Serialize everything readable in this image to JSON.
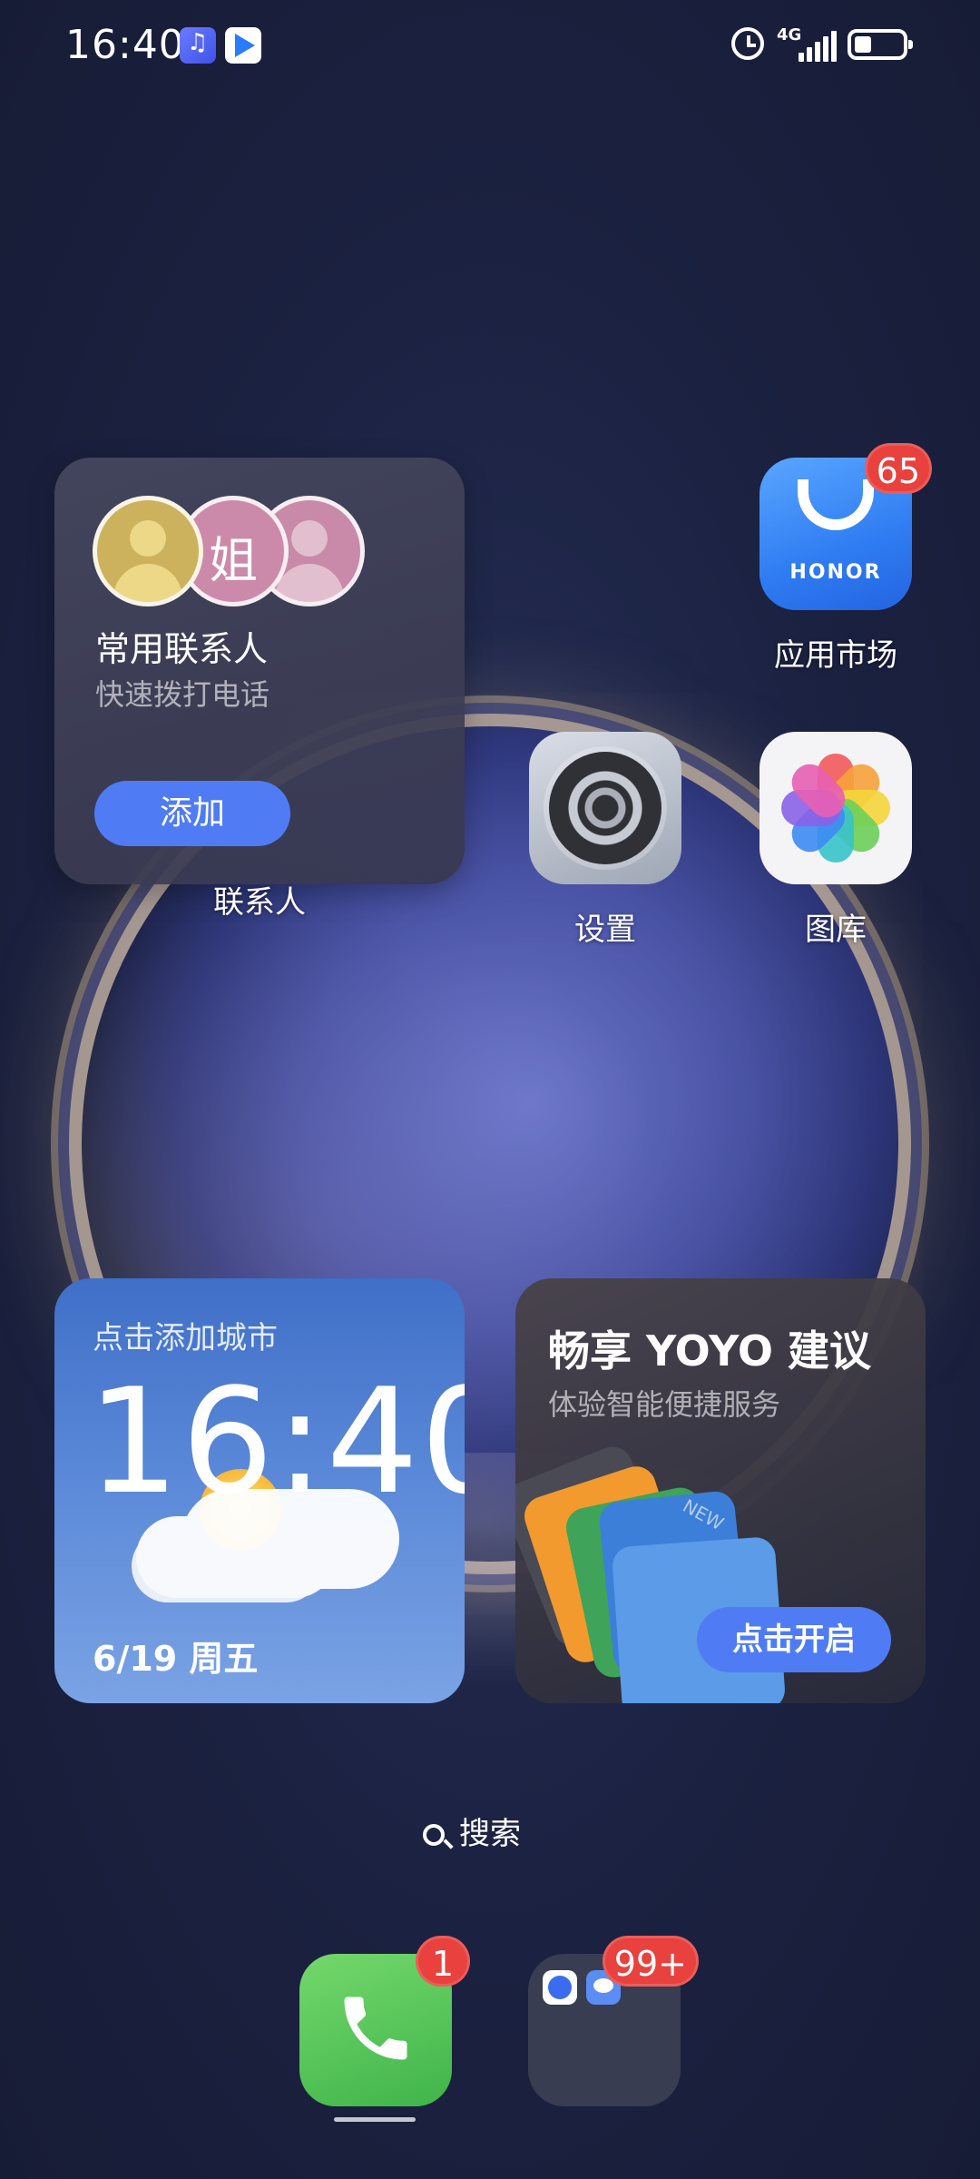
{
  "status_bar": {
    "time": "16:40",
    "network": "4G",
    "notification_icons": [
      "music-icon",
      "video-icon"
    ],
    "system_icons": [
      "alarm-icon",
      "signal-icon",
      "battery-icon"
    ]
  },
  "contacts_widget": {
    "title": "常用联系人",
    "subtitle": "快速拨打电话",
    "avatar_initial": "姐",
    "add_button": "添加",
    "label": "联系人"
  },
  "apps": {
    "app_market": {
      "label": "应用市场",
      "badge": "65",
      "logo_text": "HONOR"
    },
    "settings": {
      "label": "设置"
    },
    "gallery": {
      "label": "图库"
    }
  },
  "clock_widget": {
    "city_hint": "点击添加城市",
    "time": "16:40",
    "date": "6/19 周五"
  },
  "yoyo_widget": {
    "title": "畅享 YOYO 建议",
    "subtitle": "体验智能便捷服务",
    "card_tag": "NEW",
    "button": "点击开启"
  },
  "search": {
    "label": "搜索"
  },
  "dock": {
    "phone_badge": "1",
    "folder_badge": "99+"
  },
  "colors": {
    "accent_button": "#4f7cf5",
    "badge_red": "#e8413e",
    "clock_widget_blue": "#5a88d8"
  }
}
